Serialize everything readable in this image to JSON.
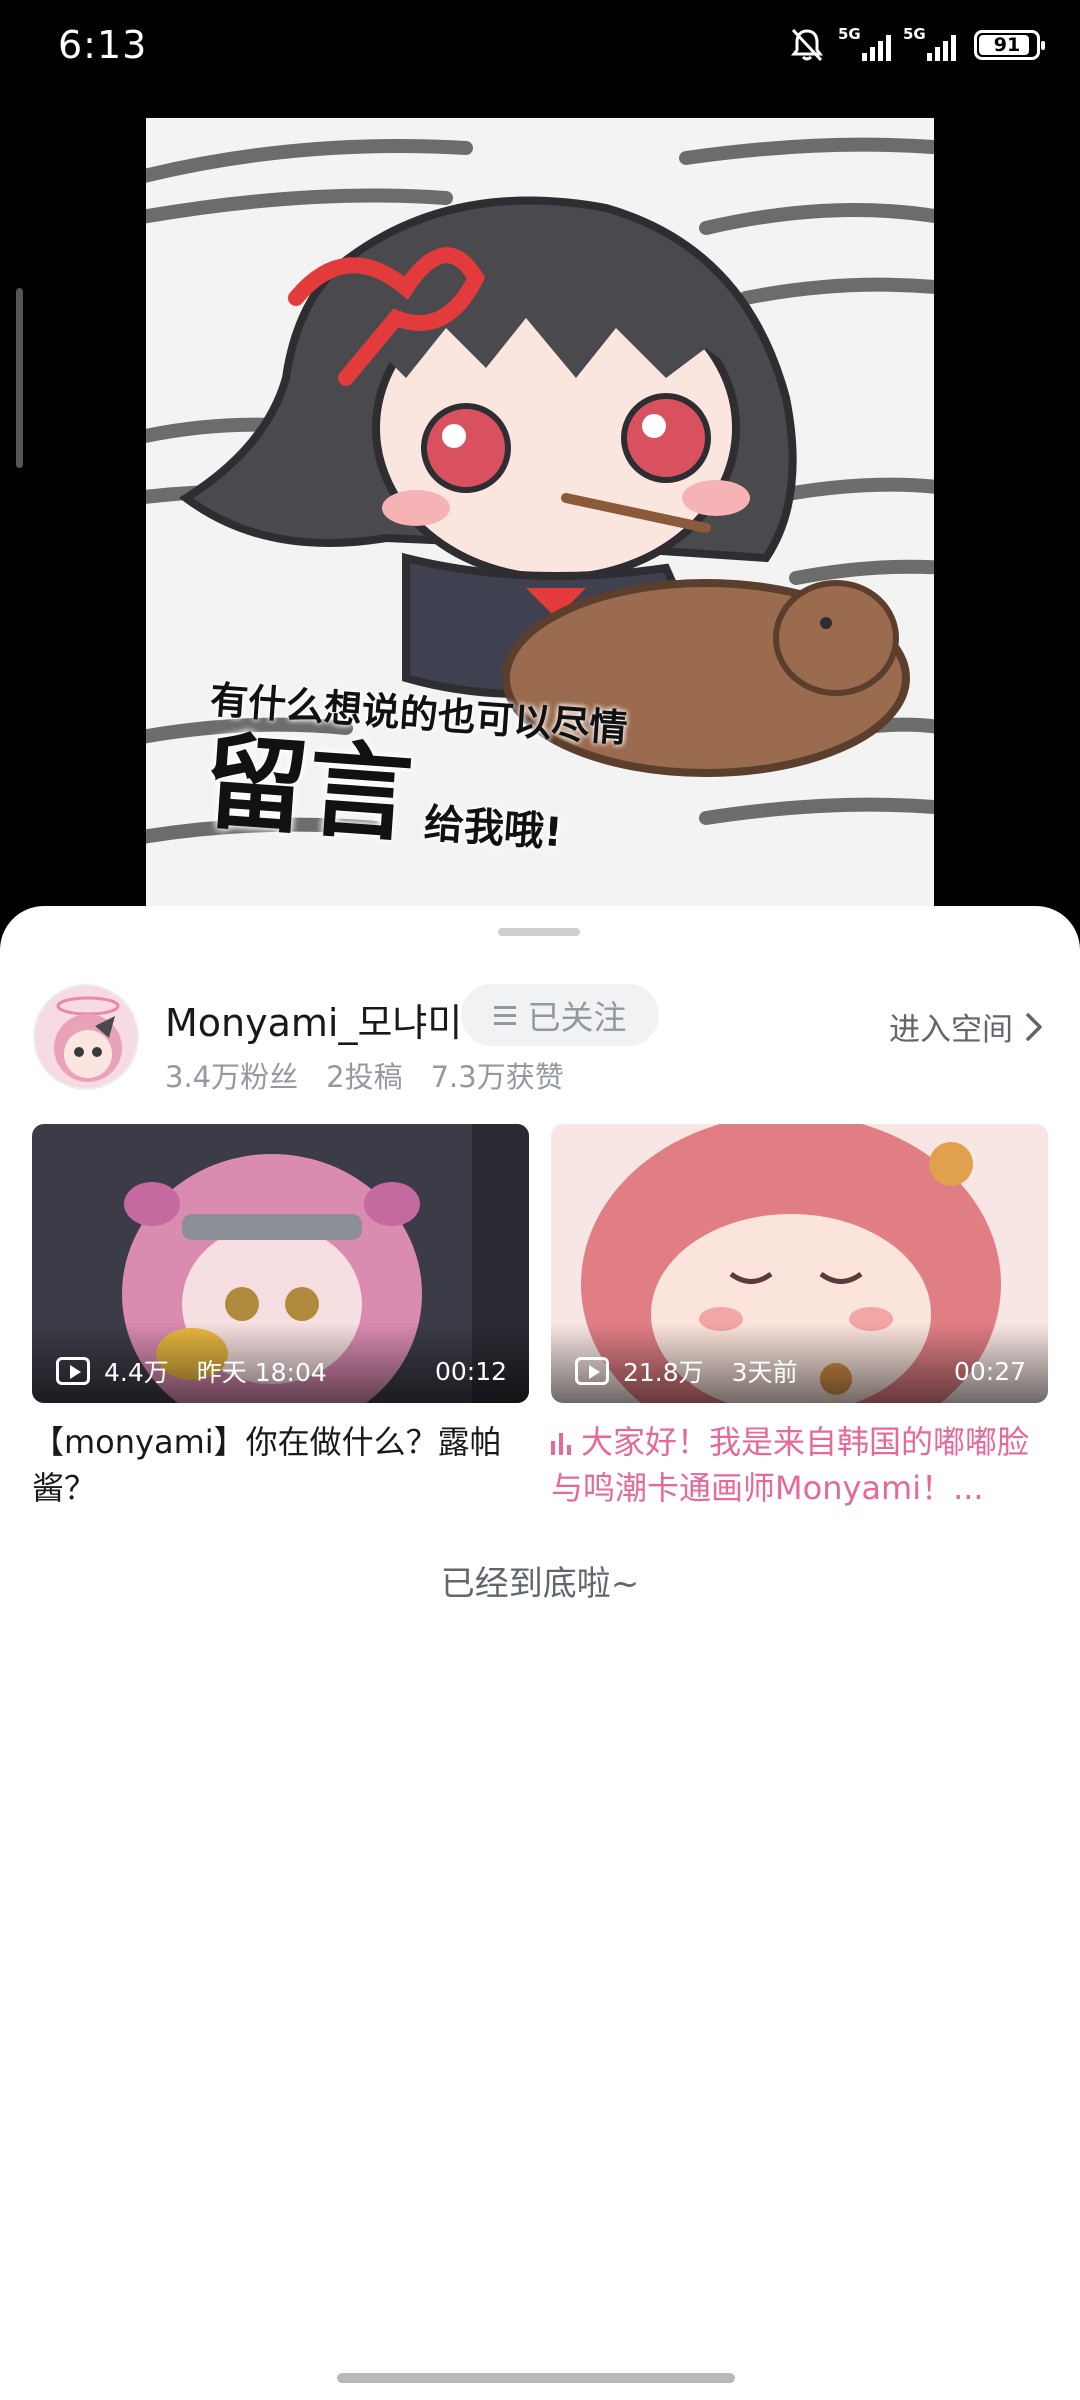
{
  "status_bar": {
    "time": "6:13",
    "network1": "5G",
    "network2": "5G",
    "battery": "91"
  },
  "artwork": {
    "caption_line1": "有什么想说的也可以尽情",
    "caption_big": "留言",
    "caption_line2": "给我哦!"
  },
  "uploader": {
    "name": "Monyami_모냐미",
    "follow_label": "已关注",
    "fans": "3.4万粉丝",
    "posts": "2投稿",
    "likes": "7.3万获赞",
    "space_label": "进入空间"
  },
  "videos": [
    {
      "plays": "4.4万",
      "date": "昨天 18:04",
      "duration": "00:12",
      "title": "【monyami】你在做什么？露帕酱？"
    },
    {
      "plays": "21.8万",
      "date": "3天前",
      "duration": "00:27",
      "title": "大家好！我是来自韩国的嘟嘟脸与鸣潮卡通画师Monyami！..."
    }
  ],
  "end_text": "已经到底啦~",
  "colors": {
    "accent_pink": "#e5699a",
    "text_primary": "#18191c",
    "text_secondary": "#9499a0"
  }
}
